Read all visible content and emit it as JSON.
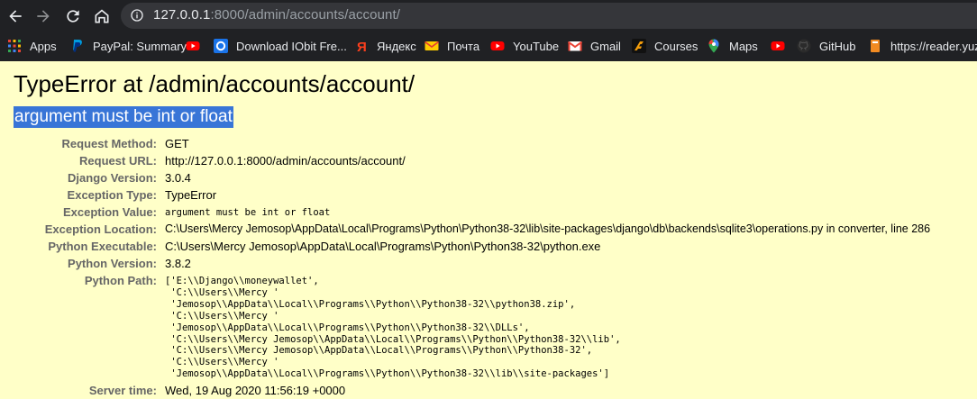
{
  "browser": {
    "url_host": "127.0.0.1",
    "url_rest": ":8000/admin/accounts/account/",
    "bookmarks": [
      {
        "label": "Apps",
        "icon": "apps-grid-icon"
      },
      {
        "label": "PayPal: Summary",
        "icon": "paypal-icon"
      },
      {
        "label": "",
        "icon": "youtube-icon"
      },
      {
        "label": "Download IObit Fre...",
        "icon": "iobit-icon"
      },
      {
        "label": "Яндекс",
        "icon": "yandex-icon"
      },
      {
        "label": "Почта",
        "icon": "mail-icon"
      },
      {
        "label": "YouTube",
        "icon": "youtube-icon"
      },
      {
        "label": "Gmail",
        "icon": "gmail-icon"
      },
      {
        "label": "Courses",
        "icon": "courses-icon"
      },
      {
        "label": "Maps",
        "icon": "maps-pin-icon"
      },
      {
        "label": "",
        "icon": "youtube-icon"
      },
      {
        "label": "GitHub",
        "icon": "github-icon"
      },
      {
        "label": "https://reader.yuzu...",
        "icon": "bookmark-icon"
      }
    ]
  },
  "error": {
    "title": "TypeError at /admin/accounts/account/",
    "message": "argument must be int or float"
  },
  "meta": [
    {
      "label": "Request Method:",
      "value": "GET"
    },
    {
      "label": "Request URL:",
      "value": "http://127.0.0.1:8000/admin/accounts/account/"
    },
    {
      "label": "Django Version:",
      "value": "3.0.4"
    },
    {
      "label": "Exception Type:",
      "value": "TypeError"
    },
    {
      "label": "Exception Value:",
      "value": "argument must be int or float"
    },
    {
      "label": "Exception Location:",
      "value": "C:\\Users\\Mercy Jemosop\\AppData\\Local\\Programs\\Python\\Python38-32\\lib\\site-packages\\django\\db\\backends\\sqlite3\\operations.py in converter, line 286"
    },
    {
      "label": "Python Executable:",
      "value": "C:\\Users\\Mercy Jemosop\\AppData\\Local\\Programs\\Python\\Python38-32\\python.exe"
    },
    {
      "label": "Python Version:",
      "value": "3.8.2"
    },
    {
      "label": "Python Path:",
      "value": "['E:\\\\Django\\\\moneywallet',\n 'C:\\\\Users\\\\Mercy '\n 'Jemosop\\\\AppData\\\\Local\\\\Programs\\\\Python\\\\Python38-32\\\\python38.zip',\n 'C:\\\\Users\\\\Mercy '\n 'Jemosop\\\\AppData\\\\Local\\\\Programs\\\\Python\\\\Python38-32\\\\DLLs',\n 'C:\\\\Users\\\\Mercy Jemosop\\\\AppData\\\\Local\\\\Programs\\\\Python\\\\Python38-32\\\\lib',\n 'C:\\\\Users\\\\Mercy Jemosop\\\\AppData\\\\Local\\\\Programs\\\\Python\\\\Python38-32',\n 'C:\\\\Users\\\\Mercy '\n 'Jemosop\\\\AppData\\\\Local\\\\Programs\\\\Python\\\\Python38-32\\\\lib\\\\site-packages']"
    },
    {
      "label": "Server time:",
      "value": "Wed, 19 Aug 2020 11:56:19 +0000"
    }
  ]
}
